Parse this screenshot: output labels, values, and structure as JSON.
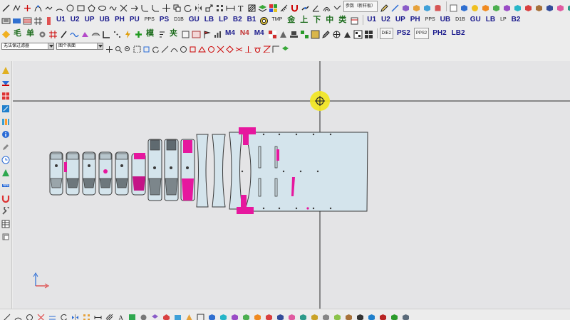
{
  "colors": {
    "canvas_bg": "#e4e4e6",
    "part_fill": "#d4e4ec",
    "part_stroke": "#3a3a3a",
    "highlight": "#e6179e",
    "crosshair": "#2a2a2a",
    "cursor_yellow": "#f2e61c",
    "toolbar_label": "#1a1a8c"
  },
  "toolbar_row2": {
    "labels": [
      "U1",
      "U2",
      "UP",
      "UB",
      "PH",
      "PU",
      "PS",
      "GU",
      "LB",
      "LP",
      "B2",
      "B1"
    ],
    "small_labels": [
      "PPS",
      "D1B",
      "TMP"
    ],
    "cjk_labels": [
      "金",
      "上",
      "下",
      "中",
      "类"
    ],
    "right_labels": [
      "U1",
      "U2",
      "UP",
      "PH",
      "UB",
      "GU",
      "LB",
      "B2"
    ],
    "right_small_labels": [
      "PPS",
      "D1B",
      "LP"
    ]
  },
  "toolbar_row3": {
    "cjk_labels": [
      "毛",
      "单",
      "模",
      "夹"
    ],
    "labels": [
      "M4",
      "N4",
      "M4"
    ],
    "right_labels": [
      "PS2",
      "PH2",
      "LB2"
    ],
    "right_small_labels": [
      "DIE2",
      "PPS2"
    ]
  },
  "toolbar_row1": {
    "box_labels": [
      "参数（新样板）"
    ]
  },
  "filter_bar": {
    "layer_filter": "无法保过滤器",
    "layer_name": "图个表面"
  },
  "left_toolbar_icons": [
    "draw-icon",
    "layer-icon",
    "grid-icon",
    "edit-icon",
    "fold-icon",
    "info-icon",
    "pen-icon",
    "clock-icon",
    "chart-icon",
    "ruler-icon",
    "magnet-icon",
    "tool-icon",
    "table-icon",
    "stack-icon"
  ],
  "bottom_toolbar_icons": [
    "line-icon",
    "arc-icon",
    "circle-icon",
    "trim-icon",
    "offset-icon",
    "rotate-icon",
    "mirror-icon",
    "array-icon",
    "dim-icon",
    "hatch-icon",
    "text-icon",
    "block-icon"
  ]
}
